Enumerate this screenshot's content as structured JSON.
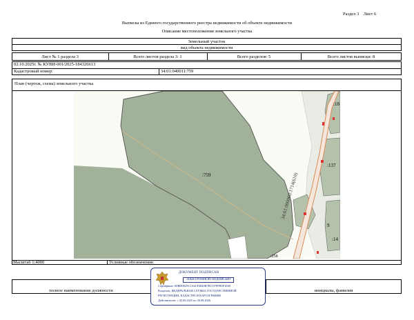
{
  "page_header": {
    "section": "Раздел 3",
    "sheet": "Лист 6"
  },
  "doc": {
    "title": "Выписка из Единого государственного реестра недвижимости об объекте недвижимости",
    "subtitle": "Описание местоположения земельного участка"
  },
  "object": {
    "name": "Земельный участок",
    "caption": "вид объекта недвижимости"
  },
  "sheet_info": {
    "sheet_num": "Лист № 1 раздела 3",
    "sheets_in_section": "Всего листов раздела 3: 1",
    "sections_total": "Всего разделов: 5",
    "sheets_total": "Всего листов выписки: 8"
  },
  "record": {
    "date_number": "02.10.2025г. № КУВИ-001/2025-184326613",
    "cadastral_label": "Кадастровый номер:",
    "cadastral_value": "34:01:040011:759"
  },
  "plan": {
    "label": "План (чертеж, схема) земельного участка"
  },
  "map_labels": {
    "main": ":759",
    "l137": ":137",
    "l18": ":18",
    "l9": "9",
    "l14": ":14",
    "l258": ":258",
    "road": "34:01:000000:1714(610)"
  },
  "footer": {
    "scale": "Масштаб 1:4000",
    "legend": "Условные обозначения:",
    "position": "полное наименование должности",
    "initials": "инициалы, фамилия"
  },
  "stamp": {
    "line1": "ДОКУМЕНТ ПОДПИСАН",
    "line2": "ЭЛЕКТРОННОЙ ПОДПИСЬЮ",
    "cert": "Сертификат: 00BD0E45C1A6CF4840B7B1197FFB5F1E69",
    "owner": "Владелец: ФЕДЕРАЛЬНАЯ СЛУЖБА ГОСУДАРСТВЕННОЙ",
    "owner2": "РЕГИСТРАЦИИ, КАДАСТРА И КАРТОГРАФИИ",
    "valid": "Действителен: с 02.06.2025 по 26.08.2026"
  },
  "colors": {
    "parcel_fill": "#a2b29a",
    "parcel_stroke": "#505050",
    "road_orange": "#d98a5a",
    "stamp_blue": "#2a3a8c"
  }
}
